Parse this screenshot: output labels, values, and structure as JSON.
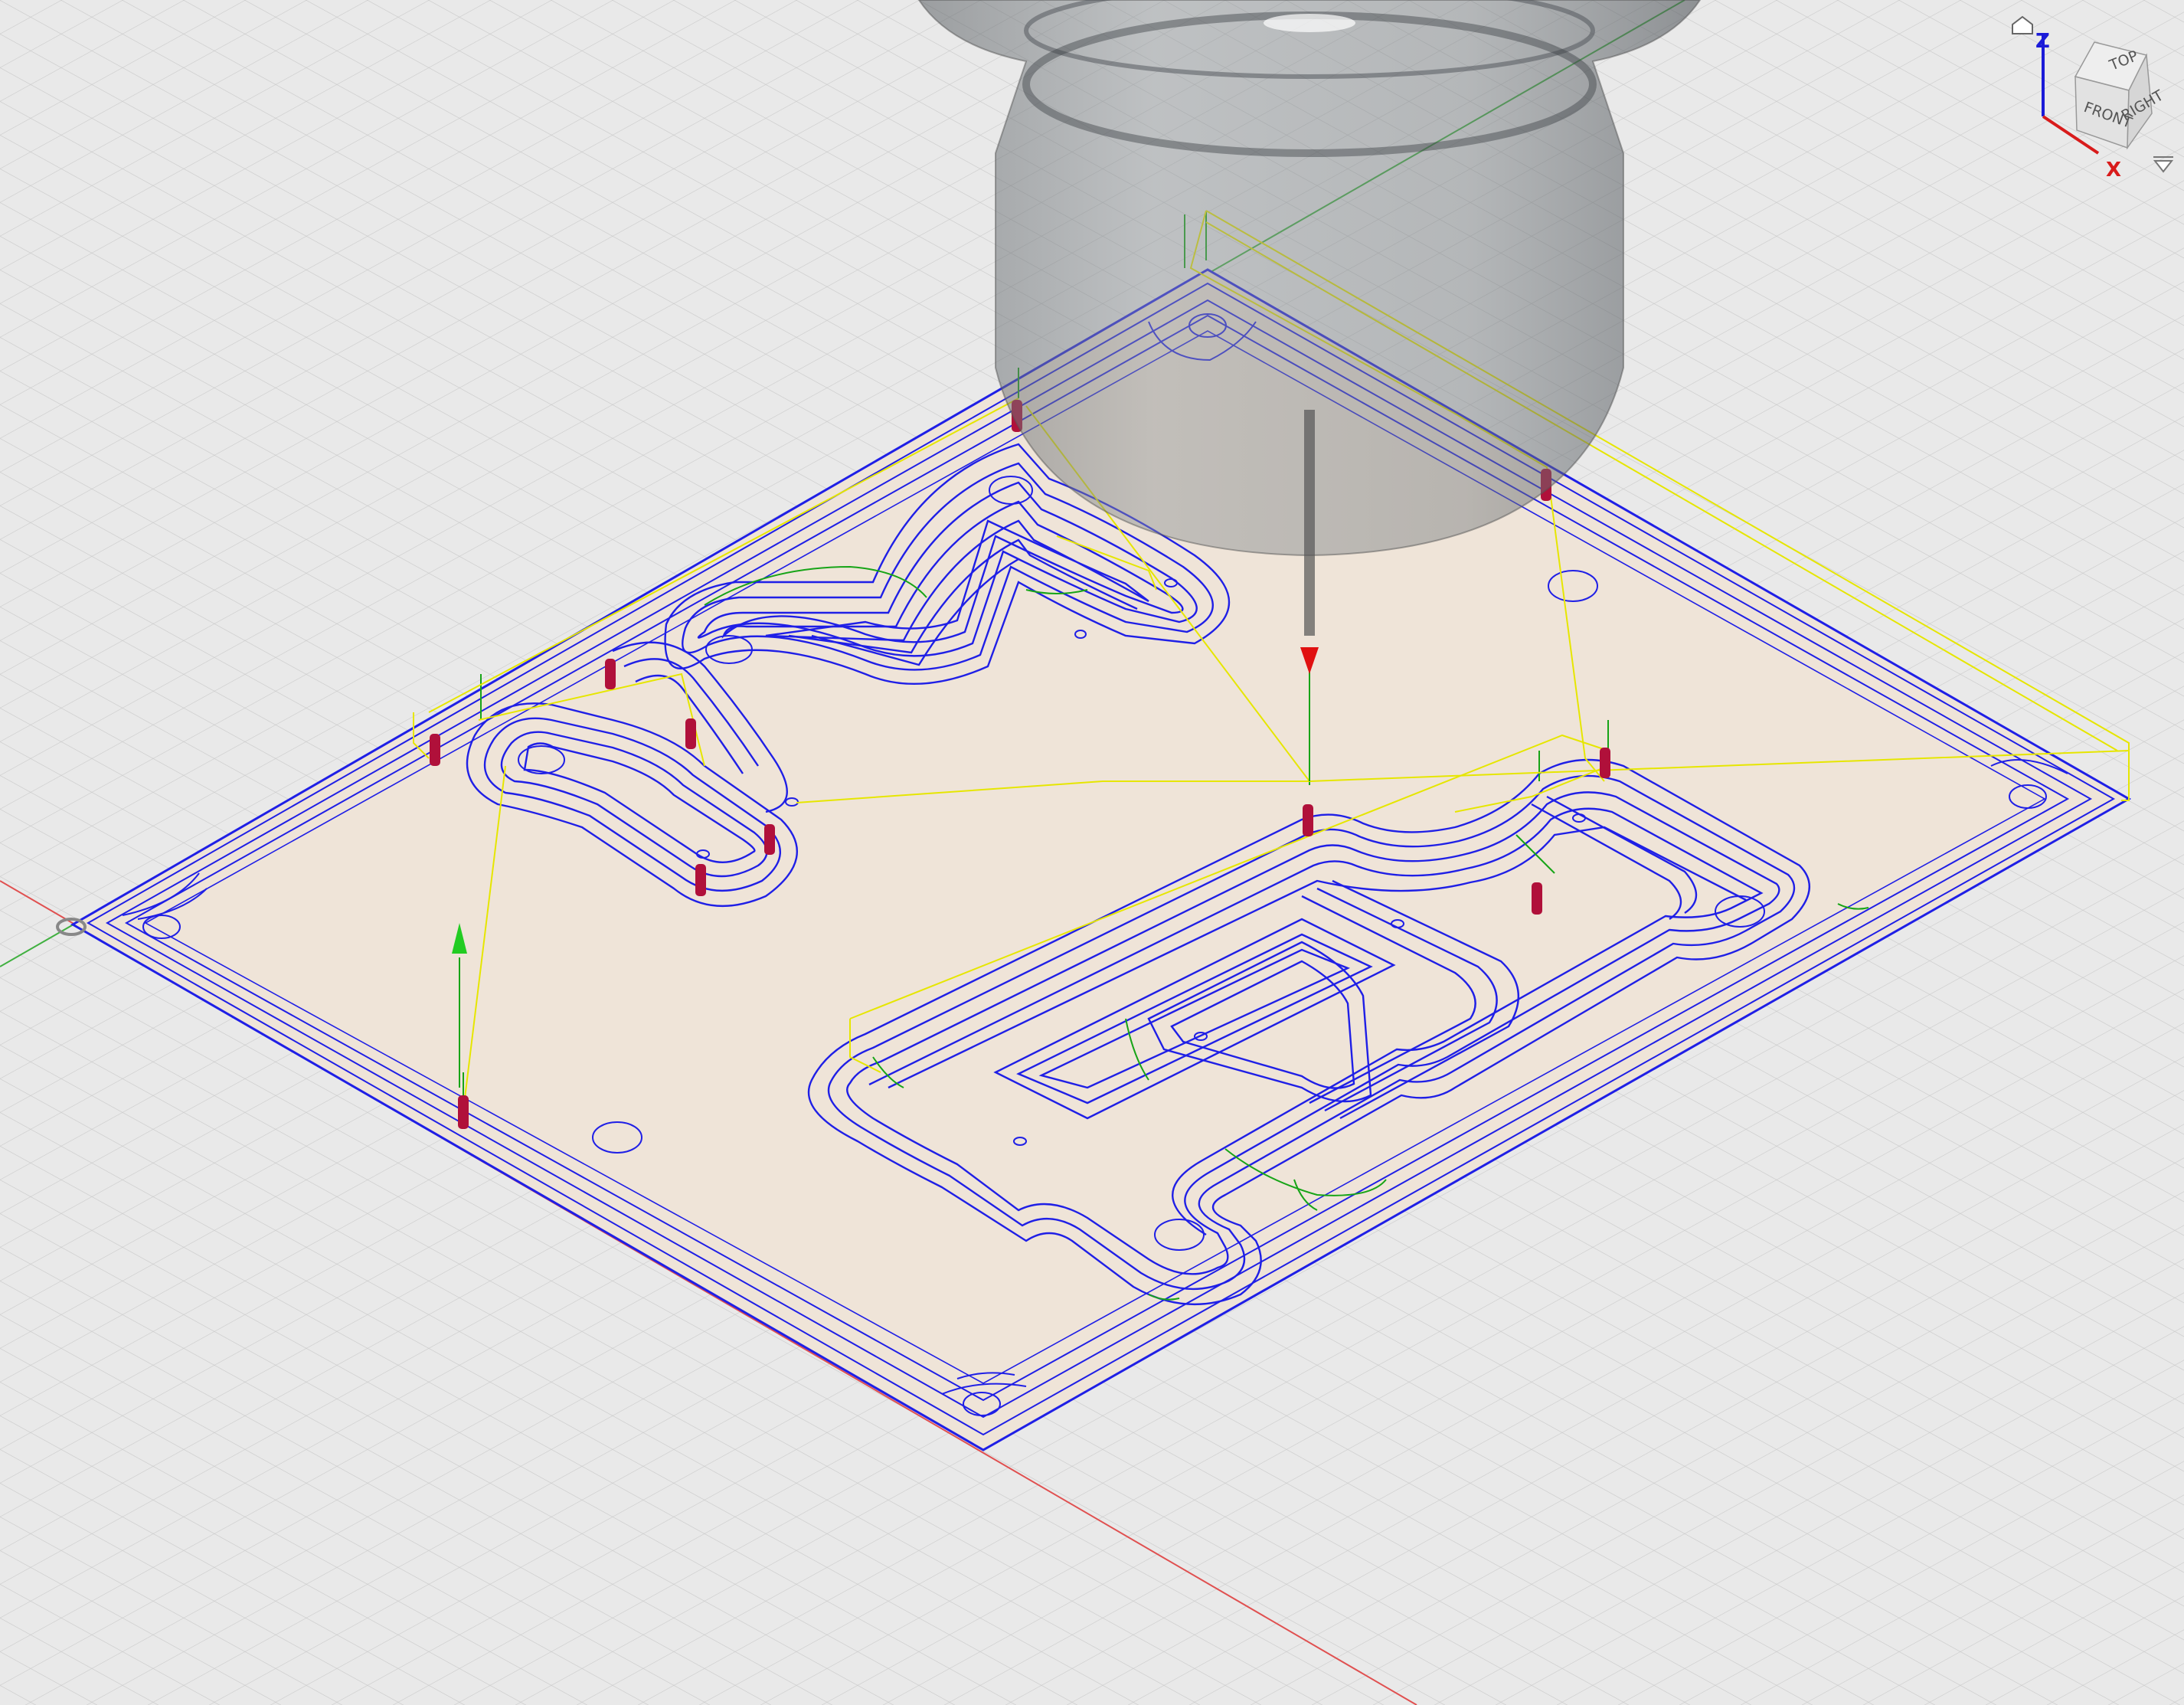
{
  "viewcube": {
    "faces": {
      "top": "TOP",
      "front": "FRONT",
      "right": "RIGHT"
    },
    "axes": {
      "z": "Z",
      "x": "X"
    },
    "icons": {
      "home": "home-icon",
      "menu": "dropdown-triangle-icon"
    }
  },
  "viewport": {
    "background": "#e9e9e9",
    "grid_color": "#c7c7c7",
    "stock_fill": "#efe4d8",
    "toolpath_color": "#1f1fe6",
    "rapid_color": "#e6e600",
    "lead_color": "#17a417",
    "plunge_marker_color": "#b0103a",
    "x_axis_color": "#e05050",
    "y_axis_color": "#40b040",
    "tool_holder_color": "#6d7378"
  }
}
